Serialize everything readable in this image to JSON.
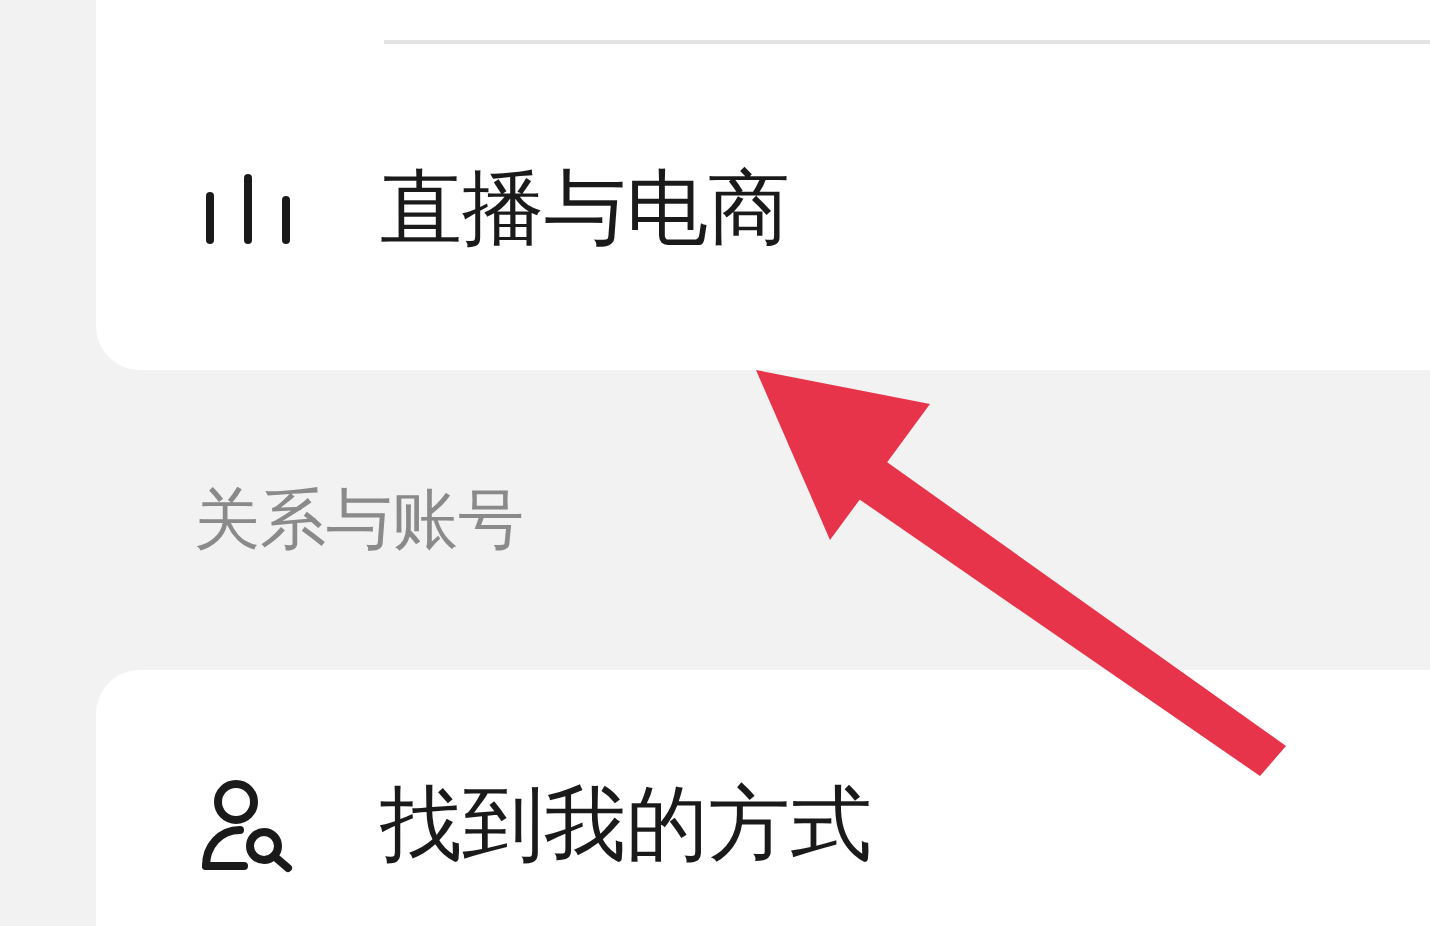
{
  "cards": [
    {
      "items": [
        {
          "label": "直播与电商",
          "kind": "bars"
        }
      ]
    },
    {
      "section": "关系与账号",
      "items": [
        {
          "label": "找到我的方式",
          "kind": "user-search"
        }
      ]
    }
  ]
}
